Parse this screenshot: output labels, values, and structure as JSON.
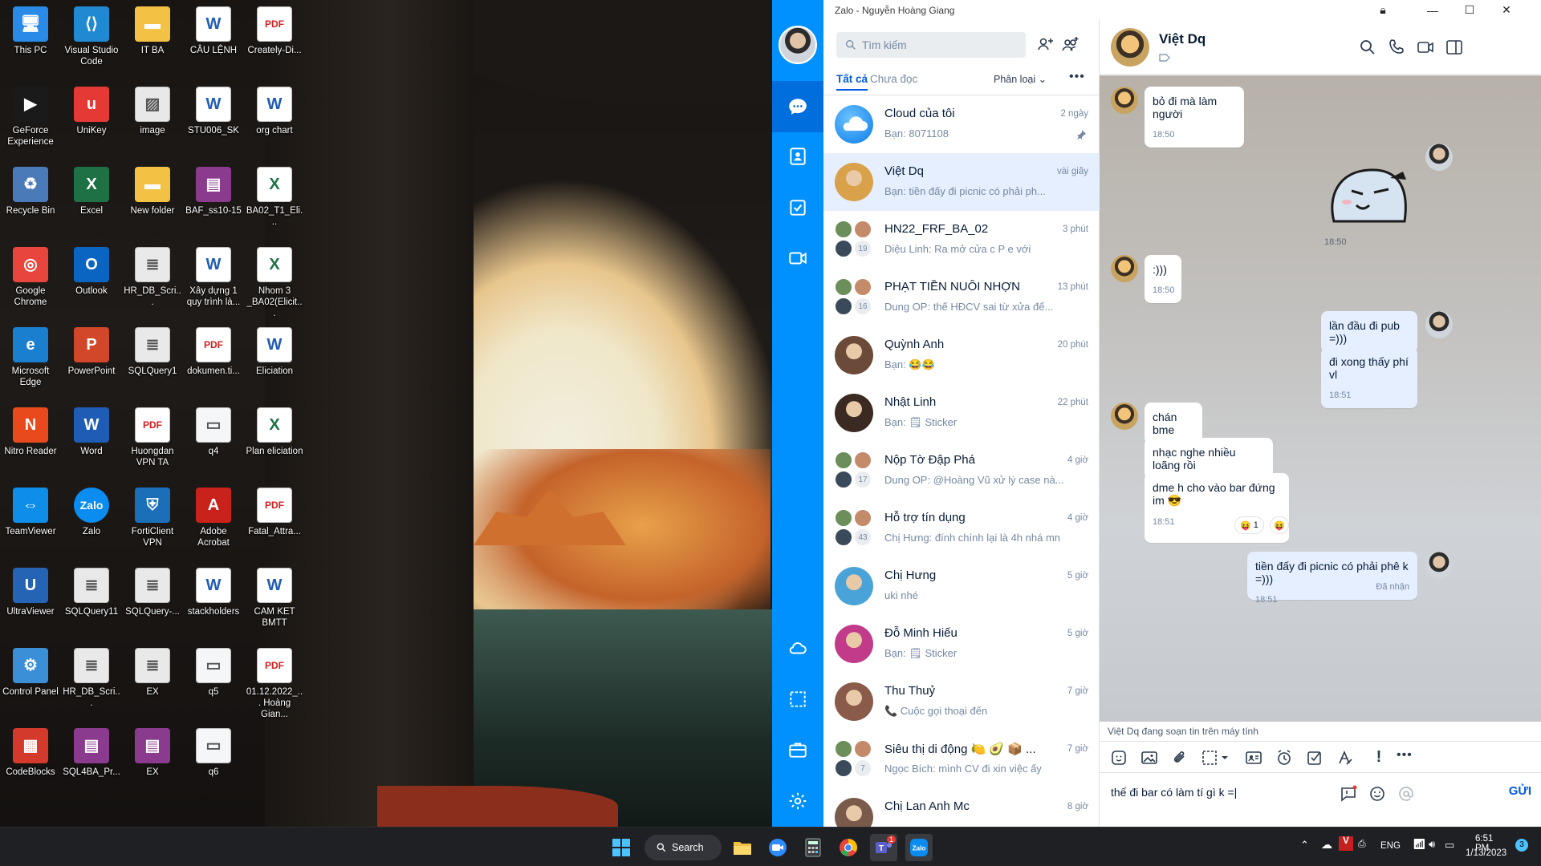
{
  "desktop": {
    "icons": [
      {
        "label": "This PC",
        "icon": "monitor-icon",
        "color": "#2a8ae8",
        "glyph": "🖥"
      },
      {
        "label": "GeForce Experience",
        "icon": "nvidia-icon",
        "color": "#1a1a1a",
        "glyph": "▶"
      },
      {
        "label": "Recycle Bin",
        "icon": "recycle-bin-icon",
        "color": "#4a7ab8",
        "glyph": "♻"
      },
      {
        "label": "Google Chrome",
        "icon": "chrome-icon",
        "color": "#e8453c",
        "glyph": "◎"
      },
      {
        "label": "Microsoft Edge",
        "icon": "edge-icon",
        "color": "#1b7fd0",
        "glyph": "e"
      },
      {
        "label": "Nitro Reader",
        "icon": "nitro-reader-icon",
        "color": "#e84a1d",
        "glyph": "N"
      },
      {
        "label": "TeamViewer",
        "icon": "teamviewer-icon",
        "color": "#0e8ee9",
        "glyph": "⇔"
      },
      {
        "label": "UltraViewer",
        "icon": "ultraviewer-icon",
        "color": "#2563b5",
        "glyph": "U"
      },
      {
        "label": "Control Panel",
        "icon": "control-panel-icon",
        "color": "#3a8fd6",
        "glyph": "⚙"
      },
      {
        "label": "CodeBlocks",
        "icon": "codeblocks-icon",
        "color": "#d33a2c",
        "glyph": "▦"
      },
      {
        "label": "Visual Studio Code",
        "icon": "vscode-icon",
        "color": "#1f8ad2",
        "glyph": "⟨⟩"
      },
      {
        "label": "UniKey",
        "icon": "unikey-icon",
        "color": "#e53935",
        "glyph": "u"
      },
      {
        "label": "Excel",
        "icon": "excel-icon",
        "color": "#1e7145",
        "glyph": "X"
      },
      {
        "label": "Outlook",
        "icon": "outlook-icon",
        "color": "#0a64c1",
        "glyph": "O"
      },
      {
        "label": "PowerPoint",
        "icon": "powerpoint-icon",
        "color": "#d2472a",
        "glyph": "P"
      },
      {
        "label": "Word",
        "icon": "word-icon",
        "color": "#1f5cb5",
        "glyph": "W"
      },
      {
        "label": "Zalo",
        "icon": "zalo-icon",
        "color": "#0a8cf0",
        "glyph": "Zalo"
      },
      {
        "label": "SQLQuery11",
        "icon": "sql-file-icon",
        "color": "#e9e9e9",
        "glyph": "≣"
      },
      {
        "label": "HR_DB_Scri...",
        "icon": "sql-file-icon",
        "color": "#e9e9e9",
        "glyph": "≣"
      },
      {
        "label": "SQL4BA_Pr...",
        "icon": "winrar-icon",
        "color": "#8a3b8e",
        "glyph": "▤"
      },
      {
        "label": "IT BA",
        "icon": "folder-icon",
        "color": "#f3c244",
        "glyph": "▬"
      },
      {
        "label": "image",
        "icon": "image-file-icon",
        "color": "#e8e8e8",
        "glyph": "▨"
      },
      {
        "label": "New folder",
        "icon": "folder-icon",
        "color": "#f3c244",
        "glyph": "▬"
      },
      {
        "label": "HR_DB_Scri...",
        "icon": "sql-file-icon",
        "color": "#e9e9e9",
        "glyph": "≣"
      },
      {
        "label": "SQLQuery1",
        "icon": "sql-file-icon",
        "color": "#e9e9e9",
        "glyph": "≣"
      },
      {
        "label": "Huongdan VPN TA",
        "icon": "pdf-icon",
        "color": "#ffffff",
        "glyph": "PDF"
      },
      {
        "label": "FortiClient VPN",
        "icon": "forticlient-icon",
        "color": "#1b6fb8",
        "glyph": "⛨"
      },
      {
        "label": "SQLQuery-...",
        "icon": "sql-file-icon",
        "color": "#e9e9e9",
        "glyph": "≣"
      },
      {
        "label": "EX",
        "icon": "sql-file-icon",
        "color": "#e9e9e9",
        "glyph": "≣"
      },
      {
        "label": "EX",
        "icon": "winrar-icon",
        "color": "#8a3b8e",
        "glyph": "▤"
      },
      {
        "label": "CÂU LỆNH",
        "icon": "word-file-icon",
        "color": "#ffffff",
        "glyph": "W"
      },
      {
        "label": "STU006_SK",
        "icon": "word-file-icon",
        "color": "#ffffff",
        "glyph": "W"
      },
      {
        "label": "BAF_ss10-15",
        "icon": "winrar-icon",
        "color": "#8a3b8e",
        "glyph": "▤"
      },
      {
        "label": "Xây dựng 1 quy trình là...",
        "icon": "word-file-icon",
        "color": "#ffffff",
        "glyph": "W"
      },
      {
        "label": "dokumen.ti...",
        "icon": "pdf-icon",
        "color": "#ffffff",
        "glyph": "PDF"
      },
      {
        "label": "q4",
        "icon": "text-file-icon",
        "color": "#f4f6f8",
        "glyph": "▭"
      },
      {
        "label": "Adobe Acrobat",
        "icon": "acrobat-icon",
        "color": "#c9221a",
        "glyph": "A"
      },
      {
        "label": "stackholders",
        "icon": "word-file-icon",
        "color": "#ffffff",
        "glyph": "W"
      },
      {
        "label": "q5",
        "icon": "text-file-icon",
        "color": "#f4f6f8",
        "glyph": "▭"
      },
      {
        "label": "q6",
        "icon": "text-file-icon",
        "color": "#f4f6f8",
        "glyph": "▭"
      },
      {
        "label": "Creately-Di...",
        "icon": "pdf-icon",
        "color": "#ffffff",
        "glyph": "PDF"
      },
      {
        "label": "org chart",
        "icon": "word-file-icon",
        "color": "#ffffff",
        "glyph": "W"
      },
      {
        "label": "BA02_T1_Eli...",
        "icon": "excel-file-icon",
        "color": "#ffffff",
        "glyph": "X"
      },
      {
        "label": "Nhom 3 _BA02(Elicit...",
        "icon": "excel-file-icon",
        "color": "#ffffff",
        "glyph": "X"
      },
      {
        "label": "Eliciation",
        "icon": "word-file-icon",
        "color": "#ffffff",
        "glyph": "W"
      },
      {
        "label": "Plan eliciation",
        "icon": "excel-file-icon",
        "color": "#ffffff",
        "glyph": "X"
      },
      {
        "label": "Fatal_Attra...",
        "icon": "pdf-icon",
        "color": "#ffffff",
        "glyph": "PDF"
      },
      {
        "label": "CAM KET BMTT",
        "icon": "word-file-icon",
        "color": "#ffffff",
        "glyph": "W"
      },
      {
        "label": "01.12.2022_... Hoàng Gian...",
        "icon": "pdf-icon",
        "color": "#ffffff",
        "glyph": "PDF"
      }
    ]
  },
  "zalo": {
    "window_title": "Zalo - Nguyễn Hoàng Giang",
    "colors": {
      "nav": "#0091ff",
      "nav_active": "#006edc",
      "accent": "#005ae0",
      "bubble_mine": "#e5efff",
      "bubble_theirs": "#ffffff"
    },
    "search_placeholder": "Tìm kiếm",
    "tabs": {
      "all": "Tất cả",
      "unread": "Chưa đọc",
      "classify": "Phân loại"
    },
    "conversations": [
      {
        "name": "Cloud của tôi",
        "time": "2 ngày",
        "preview": "Bạn: 8071108",
        "type": "cloud",
        "pinned": true
      },
      {
        "name": "Việt Dq",
        "time": "vài giây",
        "preview": "Bạn: tiền đấy đi picnic có phải ph...",
        "type": "single",
        "color": "#d9a24a",
        "active": true
      },
      {
        "name": "HN22_FRF_BA_02",
        "time": "3 phút",
        "preview": "Diệu Linh: Ra mở cửa c P e với",
        "type": "group",
        "count": "19"
      },
      {
        "name": "PHẠT TIỀN NUÔI NHỢN",
        "time": "13 phút",
        "preview": "Dung OP: thế HĐCV sai từ xửa đế...",
        "type": "group",
        "count": "16"
      },
      {
        "name": "Quỳnh Anh",
        "time": "20 phút",
        "preview": "Bạn: 😂😂",
        "type": "single",
        "color": "#6b4a3a"
      },
      {
        "name": "Nhật Linh",
        "time": "22 phút",
        "preview": "Bạn: 🗒 Sticker",
        "type": "single",
        "color": "#3a2a22"
      },
      {
        "name": "Nộp Tờ Đập Phá",
        "time": "4 giờ",
        "preview": "Dung OP: @Hoàng Vũ xử lý case nà...",
        "type": "group",
        "count": "17"
      },
      {
        "name": "Hỗ trợ tín dụng",
        "time": "4 giờ",
        "preview": "Chị Hưng: đính chính lại là 4h nhá mn",
        "type": "group",
        "count": "43"
      },
      {
        "name": "Chị Hưng",
        "time": "5 giờ",
        "preview": "uki nhé",
        "type": "single",
        "color": "#4aa3d8"
      },
      {
        "name": "Đỗ Minh Hiếu",
        "time": "5 giờ",
        "preview": "Bạn: 🗒 Sticker",
        "type": "single",
        "color": "#c23a8a"
      },
      {
        "name": "Thu Thuỷ",
        "time": "7 giờ",
        "preview": "📞 Cuộc gọi thoại đến",
        "type": "single",
        "color": "#8a5a4a"
      },
      {
        "name": "Siêu thị di động 🍋 🥑 📦 ...",
        "time": "7 giờ",
        "preview": "Ngọc Bích: mình CV đi xin việc ấy",
        "type": "group",
        "count": "7"
      },
      {
        "name": "Chị Lan Anh Mc",
        "time": "8 giờ",
        "preview": "",
        "type": "single",
        "color": "#7a5a4a"
      }
    ],
    "chat": {
      "name": "Việt Dq",
      "messages": [
        {
          "text": "bỏ đi mà làm người",
          "time": "18:50"
        },
        {
          "time": "18:50"
        },
        {
          "text": ":)))",
          "time": "18:50"
        },
        {
          "text": "lần đầu đi pub =)))"
        },
        {
          "text": "đi xong thấy phí vl",
          "time": "18:51"
        },
        {
          "text": "chán bme"
        },
        {
          "text": "nhạc nghe nhiều loãng rồi"
        },
        {
          "text": "dme h cho vào bar đứng im 😎",
          "time": "18:51",
          "reaction_count": "1"
        },
        {
          "text": "tiền đấy đi picnic có phải phê k =)))",
          "time": "18:51",
          "status": "Đã nhận"
        }
      ],
      "typing": "Việt Dq đang soạn tin trên máy tính  • • •",
      "composer_value": "thế đi bar có làm tí gì k =|",
      "send_label": "GỬI"
    }
  },
  "taskbar": {
    "search_label": "Search",
    "language": "ENG",
    "time": "6:51 PM",
    "date": "1/13/2023",
    "notification_count": "3",
    "teams_badge": "1"
  }
}
